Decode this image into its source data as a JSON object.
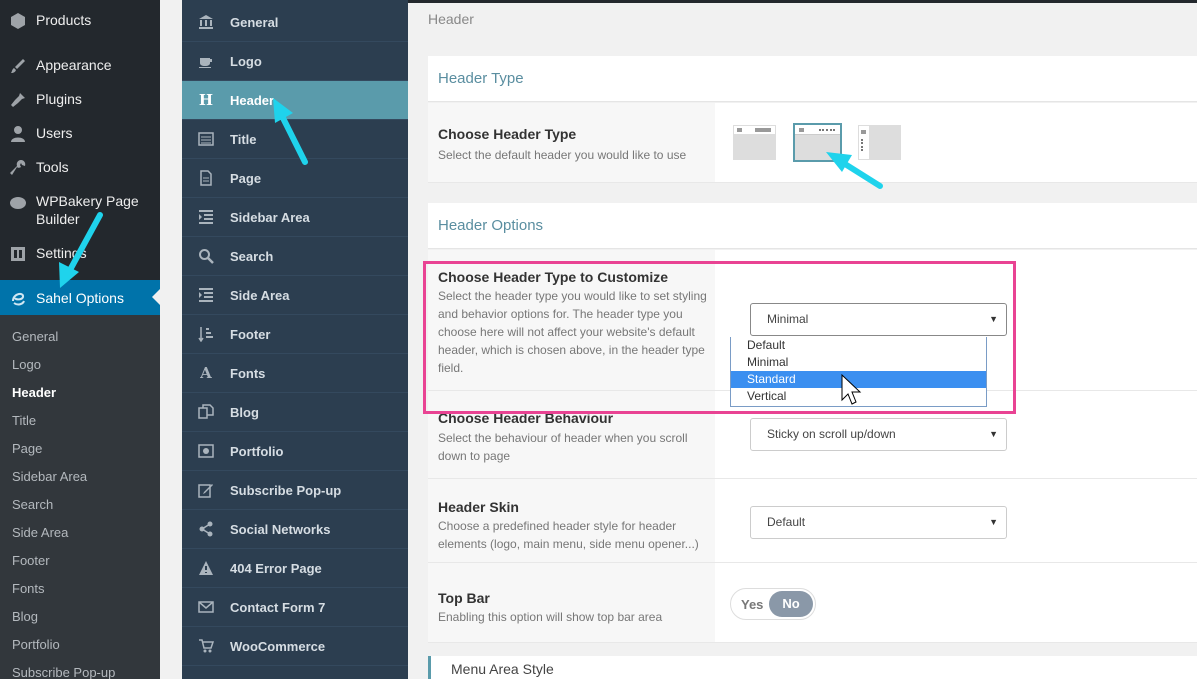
{
  "wp_sidebar": {
    "items": [
      {
        "label": "Products",
        "icon": "products-icon"
      },
      {
        "label": "Appearance",
        "icon": "brush-icon"
      },
      {
        "label": "Plugins",
        "icon": "plugin-icon"
      },
      {
        "label": "Users",
        "icon": "user-icon"
      },
      {
        "label": "Tools",
        "icon": "wrench-icon"
      },
      {
        "label": "WPBakery Page Builder",
        "icon": "wpbakery-icon"
      },
      {
        "label": "Settings",
        "icon": "settings-icon"
      },
      {
        "label": "Sahel Options",
        "icon": "sahel-icon"
      }
    ],
    "submenu": [
      "General",
      "Logo",
      "Header",
      "Title",
      "Page",
      "Sidebar Area",
      "Search",
      "Side Area",
      "Footer",
      "Fonts",
      "Blog",
      "Portfolio",
      "Subscribe Pop-up"
    ],
    "submenu_current": "Header"
  },
  "options_nav": {
    "items": [
      {
        "label": "General",
        "icon": "bank-icon"
      },
      {
        "label": "Logo",
        "icon": "coffee-icon"
      },
      {
        "label": "Header",
        "icon": "h-letter-icon"
      },
      {
        "label": "Title",
        "icon": "list-icon"
      },
      {
        "label": "Page",
        "icon": "file-icon"
      },
      {
        "label": "Sidebar Area",
        "icon": "indent-icon"
      },
      {
        "label": "Search",
        "icon": "search-icon"
      },
      {
        "label": "Side Area",
        "icon": "indent-icon"
      },
      {
        "label": "Footer",
        "icon": "sort-icon"
      },
      {
        "label": "Fonts",
        "icon": "font-icon"
      },
      {
        "label": "Blog",
        "icon": "copy-icon"
      },
      {
        "label": "Portfolio",
        "icon": "image-icon"
      },
      {
        "label": "Subscribe Pop-up",
        "icon": "edit-icon"
      },
      {
        "label": "Social Networks",
        "icon": "share-icon"
      },
      {
        "label": "404 Error Page",
        "icon": "warning-icon"
      },
      {
        "label": "Contact Form 7",
        "icon": "envelope-icon"
      },
      {
        "label": "WooCommerce",
        "icon": "cart-icon"
      }
    ],
    "active": "Header"
  },
  "main": {
    "page_title": "Header",
    "header_type_section": "Header Type",
    "choose_header_type": {
      "title": "Choose Header Type",
      "desc": "Select the default header you would like to use"
    },
    "header_options_section": "Header Options",
    "customize": {
      "title": "Choose Header Type to Customize",
      "desc": "Select the header type you would like to set styling and behavior options for. The header type you choose here will not affect your website's default header, which is chosen above, in the header type field.",
      "selected": "Minimal",
      "options": [
        "Default",
        "Minimal",
        "Standard",
        "Vertical"
      ],
      "highlighted": "Standard"
    },
    "behaviour": {
      "title": "Choose Header Behaviour",
      "desc": "Select the behaviour of header when you scroll down to page",
      "selected": "Sticky on scroll up/down"
    },
    "skin": {
      "title": "Header Skin",
      "desc": "Choose a predefined header style for header elements (logo, main menu, side menu opener...)",
      "selected": "Default"
    },
    "top_bar": {
      "title": "Top Bar",
      "desc": "Enabling this option will show top bar area",
      "yes": "Yes",
      "no": "No",
      "value": "No"
    },
    "menu_area_style": "Menu Area Style"
  },
  "colors": {
    "wp_dark": "#23282d",
    "wp_blue": "#0073aa",
    "options_nav": "#2c3e50",
    "options_active": "#5a9bab",
    "annotation_arrow": "#1fd3ec",
    "annotation_box": "#e94393"
  }
}
